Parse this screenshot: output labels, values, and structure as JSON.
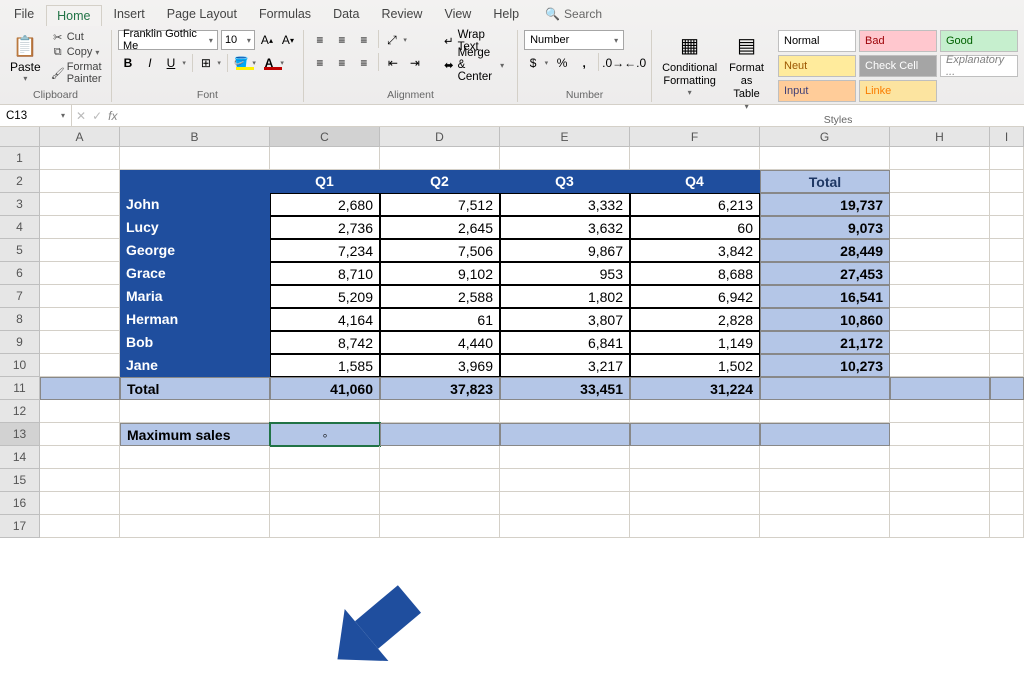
{
  "tabs": {
    "file": "File",
    "home": "Home",
    "insert": "Insert",
    "pagelayout": "Page Layout",
    "formulas": "Formulas",
    "data": "Data",
    "review": "Review",
    "view": "View",
    "help": "Help",
    "search": "Search"
  },
  "clipboard": {
    "paste": "Paste",
    "cut": "Cut",
    "copy": "Copy",
    "format_painter": "Format Painter",
    "group": "Clipboard"
  },
  "font": {
    "name": "Franklin Gothic Me",
    "size": "10",
    "group": "Font"
  },
  "alignment": {
    "wrap": "Wrap Text",
    "merge": "Merge & Center",
    "group": "Alignment"
  },
  "number": {
    "format": "Number",
    "group": "Number"
  },
  "styles": {
    "cond": "Conditional\nFormatting",
    "fmt_table": "Format as\nTable",
    "normal": "Normal",
    "bad": "Bad",
    "good": "Good",
    "neutral": "Neut",
    "check": "Check Cell",
    "expl": "Explanatory ...",
    "input": "Input",
    "linked": "Linke",
    "group": "Styles"
  },
  "namebox": "C13",
  "cols": [
    "A",
    "B",
    "C",
    "D",
    "E",
    "F",
    "G",
    "H",
    "I"
  ],
  "rows": [
    "1",
    "2",
    "3",
    "4",
    "5",
    "6",
    "7",
    "8",
    "9",
    "10",
    "11",
    "12",
    "13",
    "14",
    "15",
    "16",
    "17"
  ],
  "table": {
    "headers": [
      "Q1",
      "Q2",
      "Q3",
      "Q4",
      "Total"
    ],
    "names": [
      "John",
      "Lucy",
      "George",
      "Grace",
      "Maria",
      "Herman",
      "Bob",
      "Jane"
    ],
    "data": [
      [
        "2,680",
        "7,512",
        "3,332",
        "6,213",
        "19,737"
      ],
      [
        "2,736",
        "2,645",
        "3,632",
        "60",
        "9,073"
      ],
      [
        "7,234",
        "7,506",
        "9,867",
        "3,842",
        "28,449"
      ],
      [
        "8,710",
        "9,102",
        "953",
        "8,688",
        "27,453"
      ],
      [
        "5,209",
        "2,588",
        "1,802",
        "6,942",
        "16,541"
      ],
      [
        "4,164",
        "61",
        "3,807",
        "2,828",
        "10,860"
      ],
      [
        "8,742",
        "4,440",
        "6,841",
        "1,149",
        "21,172"
      ],
      [
        "1,585",
        "3,969",
        "3,217",
        "1,502",
        "10,273"
      ]
    ],
    "total_label": "Total",
    "totals": [
      "41,060",
      "37,823",
      "33,451",
      "31,224",
      ""
    ],
    "max_label": "Maximum sales"
  }
}
